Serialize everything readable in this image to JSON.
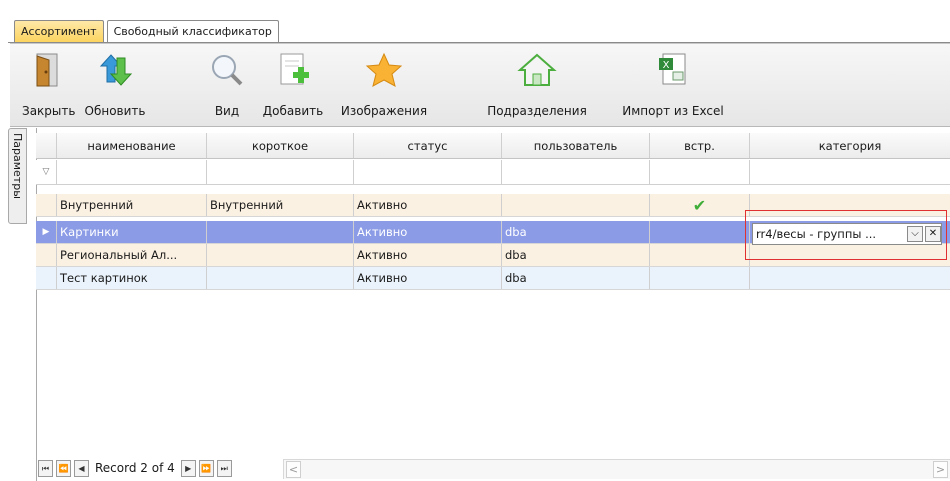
{
  "tabs": [
    {
      "label": "Ассортимент"
    },
    {
      "label": "Свободный классификатор"
    }
  ],
  "ribbon": {
    "buttons": [
      {
        "label": "Закрыть",
        "icon": "door-icon"
      },
      {
        "label": "Обновить",
        "icon": "refresh-arrows-icon"
      },
      {
        "label": "Вид",
        "icon": "magnifier-icon"
      },
      {
        "label": "Добавить",
        "icon": "add-document-icon"
      },
      {
        "label": "Изображения",
        "icon": "star-icon"
      },
      {
        "label": "Подразделения",
        "icon": "house-icon"
      },
      {
        "label": "Импорт из Excel",
        "icon": "excel-icon"
      }
    ]
  },
  "side_tab": {
    "label": "Параметры"
  },
  "grid": {
    "columns": [
      "наименование",
      "короткое",
      "статус",
      "пользователь",
      "встр.",
      "категория"
    ],
    "rows": [
      {
        "name": "Внутренний",
        "short": "Внутренний",
        "status": "Активно",
        "user": "",
        "builtin": true,
        "category": ""
      },
      {
        "name": "Картинки",
        "short": "",
        "status": "Активно",
        "user": "dba",
        "builtin": false,
        "category": "rr4/весы - группы ..."
      },
      {
        "name": "Региональный Ал...",
        "short": "",
        "status": "Активно",
        "user": "dba",
        "builtin": false,
        "category": ""
      },
      {
        "name": "Тест картинок",
        "short": "",
        "status": "Активно",
        "user": "dba",
        "builtin": false,
        "category": ""
      }
    ],
    "selected_row": 1,
    "editor_value": "rr4/весы - группы ..."
  },
  "navigator": {
    "record_text": "Record 2 of 4"
  },
  "colors": {
    "selected_row": "#8b9be6",
    "row_odd": "#fbf1e3",
    "row_even": "#eaf3fb",
    "active_tab": "#fcd35b",
    "highlight_border": "#e03030"
  }
}
